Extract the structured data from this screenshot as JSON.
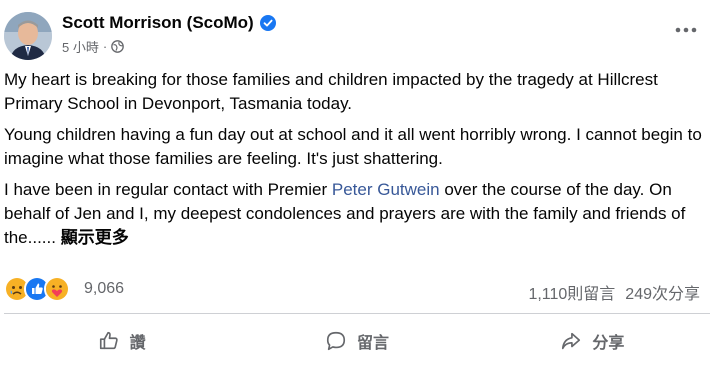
{
  "post": {
    "author": "Scott Morrison (ScoMo)",
    "time": "5 小時",
    "separator": "·",
    "paragraphs": {
      "p1": "My heart is breaking for those families and children impacted by the tragedy at Hillcrest Primary School in Devonport, Tasmania today.",
      "p2": "Young children having a fun day out at school and it all went horribly wrong. I cannot begin to imagine what those families are feeling. It's just shattering.",
      "p3_before": "I have been in regular contact with Premier ",
      "p3_link": "Peter Gutwein",
      "p3_after": " over the course of the day. On behalf of Jen and I, my deepest condolences and prayers are with the family and friends of the...... "
    },
    "see_more": "顯示更多"
  },
  "reactions": {
    "count": "9,066",
    "icons": [
      "sad-reaction",
      "like-reaction",
      "care-reaction"
    ],
    "comments": "1,110則留言",
    "shares": "249次分享"
  },
  "actions": {
    "like": "讚",
    "comment": "留言",
    "share": "分享"
  },
  "colors": {
    "verified": "#1877f2",
    "link": "#385898",
    "secondary_text": "#65676b",
    "like_blue": "#1877f2",
    "sad_yellow": "#f7b125"
  }
}
